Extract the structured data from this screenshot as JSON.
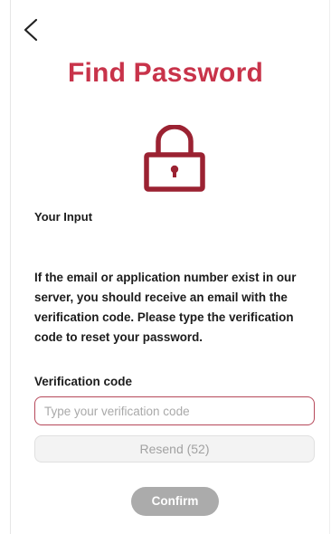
{
  "header": {
    "back_icon": "chevron-left-icon",
    "title": "Find Password"
  },
  "colors": {
    "accent": "#c8334a",
    "lock": "#9b2232",
    "input_border": "#b6485a",
    "confirm_bg": "#ababab"
  },
  "lock_icon": "lock-icon",
  "section_label": "Your Input",
  "info_text": "If the email or application number exist in our server, you should receive an email with the verification code. Please type the verification code to reset your password.",
  "form": {
    "verification_label": "Verification code",
    "verification_placeholder": "Type your verification code",
    "verification_value": "",
    "resend_label": "Resend (52)",
    "confirm_label": "Confirm"
  }
}
